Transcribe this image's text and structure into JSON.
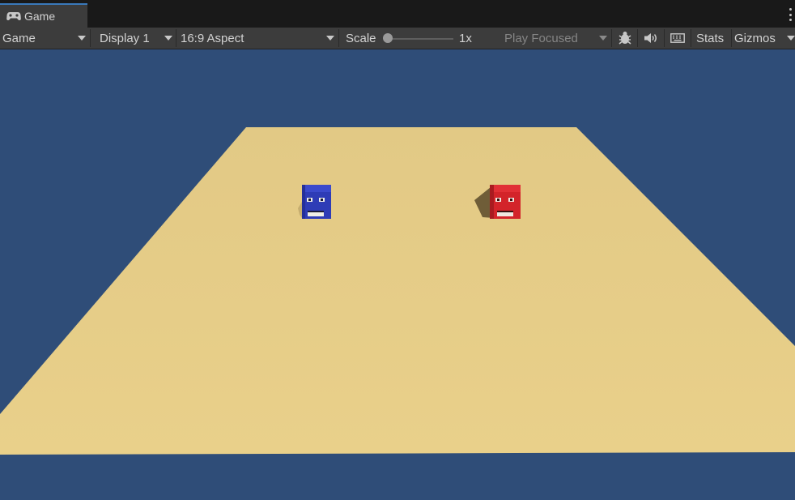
{
  "tab": {
    "label": "Game",
    "icon": "gamepad-icon"
  },
  "toolbar": {
    "view_mode": "Game",
    "display": "Display 1",
    "aspect": "16:9 Aspect",
    "scale_label": "Scale",
    "scale_value": "1x",
    "play_mode": "Play Focused",
    "stats_label": "Stats",
    "gizmos_label": "Gizmos"
  },
  "scene": {
    "sky_color": "#2f4d78",
    "ground_color": "#e4c882",
    "characters": [
      {
        "name": "blue-cube-character",
        "color": "#2e3db8"
      },
      {
        "name": "red-cube-character",
        "color": "#d8242a"
      }
    ]
  }
}
